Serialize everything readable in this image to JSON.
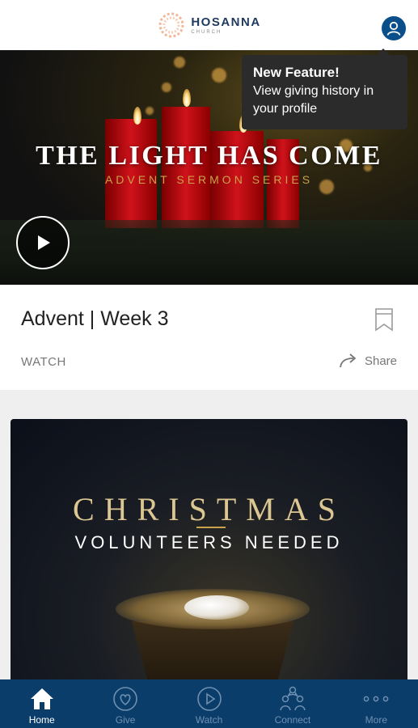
{
  "header": {
    "logo_name": "HOSANNA",
    "logo_sub": "CHURCH"
  },
  "tooltip": {
    "title": "New Feature!",
    "body": "View giving history in your profile"
  },
  "hero": {
    "title": "THE LIGHT HAS COME",
    "subtitle": "ADVENT SERMON SERIES"
  },
  "card": {
    "title": "Advent | Week 3",
    "type_label": "WATCH",
    "share_label": "Share"
  },
  "promo": {
    "title": "CHRISTMAS",
    "subtitle": "VOLUNTEERS NEEDED"
  },
  "tabs": [
    {
      "label": "Home",
      "icon": "home-icon",
      "active": true
    },
    {
      "label": "Give",
      "icon": "heart-icon",
      "active": false
    },
    {
      "label": "Watch",
      "icon": "play-circle-icon",
      "active": false
    },
    {
      "label": "Connect",
      "icon": "people-icon",
      "active": false
    },
    {
      "label": "More",
      "icon": "more-icon",
      "active": false
    }
  ],
  "colors": {
    "brand": "#0b3d6b",
    "accent_gold": "#c9a24a",
    "tab_inactive": "#6f8fb0"
  }
}
